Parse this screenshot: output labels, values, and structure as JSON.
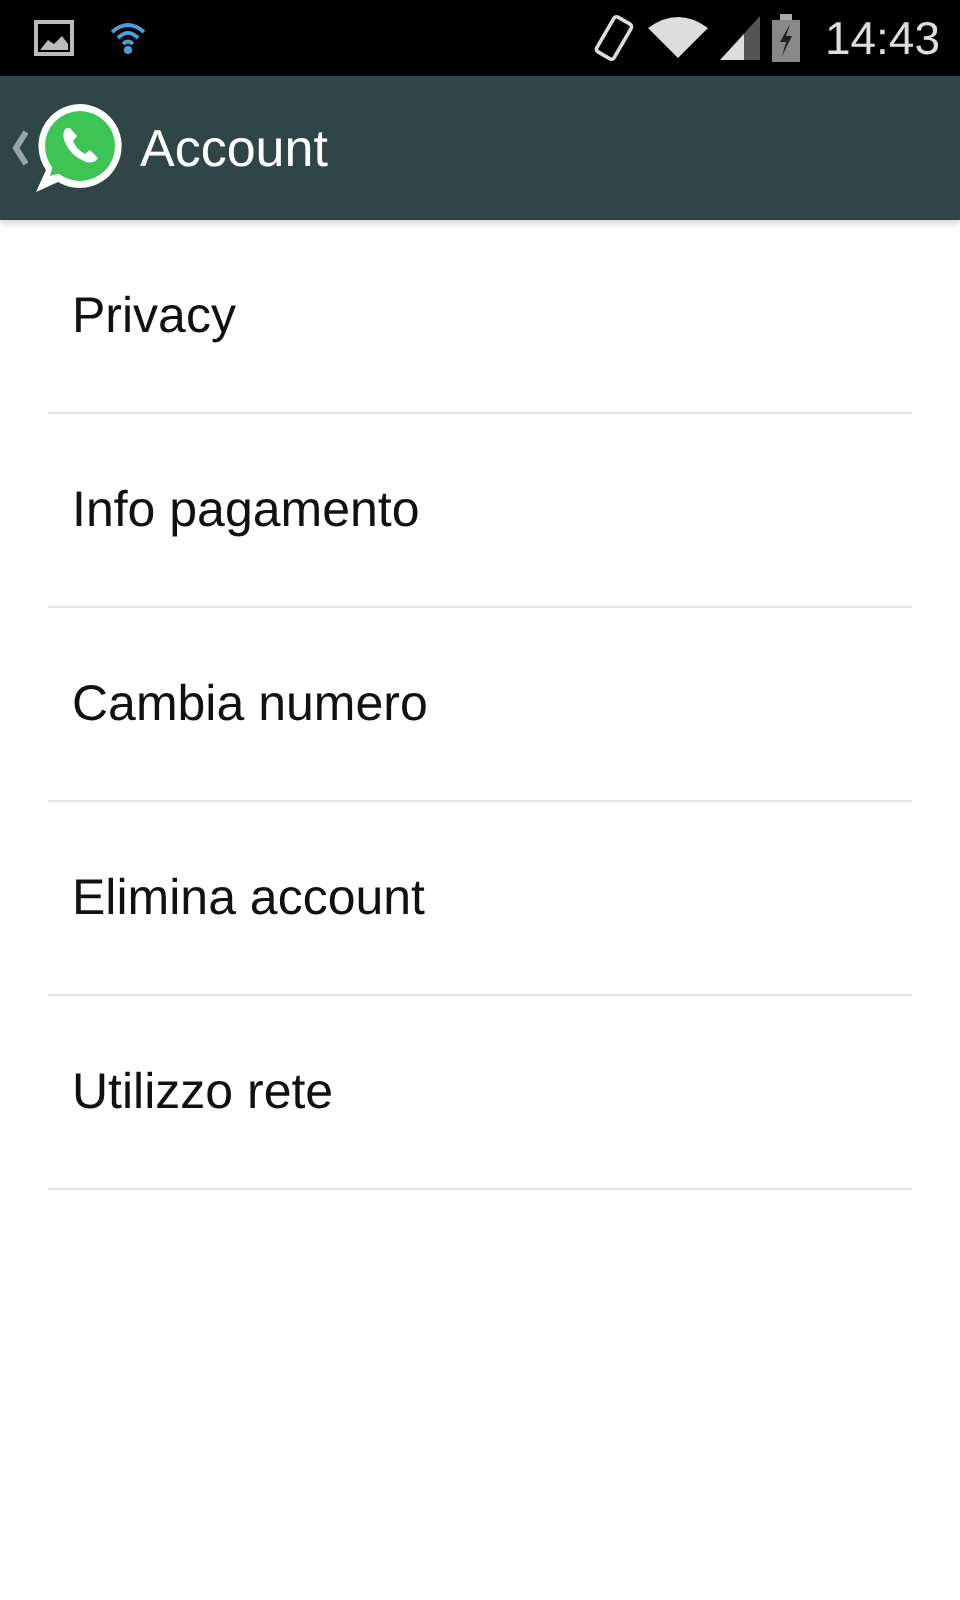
{
  "status_bar": {
    "time": "14:43"
  },
  "action_bar": {
    "title": "Account"
  },
  "menu_items": [
    {
      "label": "Privacy"
    },
    {
      "label": "Info pagamento"
    },
    {
      "label": "Cambia numero"
    },
    {
      "label": "Elimina account"
    },
    {
      "label": "Utilizzo rete"
    }
  ]
}
